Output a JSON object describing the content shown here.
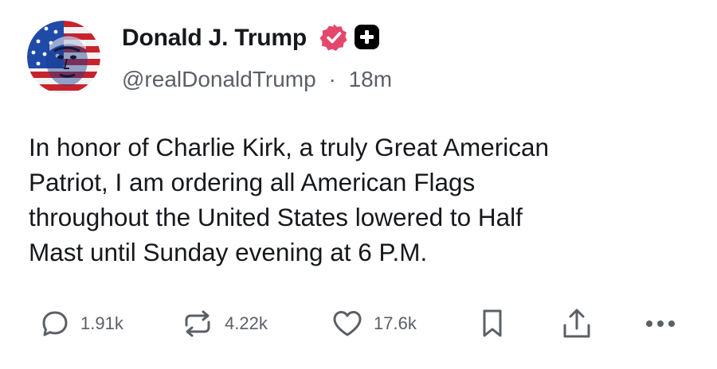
{
  "author": {
    "display_name": "Donald J. Trump",
    "handle": "@realDonaldTrump",
    "separator": "·",
    "timestamp": "18m",
    "avatar_icon": "flag-portrait-avatar",
    "verified_icon": "verified-badge-icon",
    "verified_color": "#e4476a",
    "plus_icon": "plus-badge-icon"
  },
  "post": {
    "text": "In honor of Charlie Kirk, a truly Great American\nPatriot, I am ordering all American Flags\nthroughout the United States lowered to Half\nMast until Sunday evening at 6 P.M."
  },
  "actions": {
    "reply": {
      "icon": "reply-bubble-icon",
      "count": "1.91k"
    },
    "repost": {
      "icon": "repost-arrows-icon",
      "count": "4.22k"
    },
    "like": {
      "icon": "heart-icon",
      "count": "17.6k"
    },
    "bookmark": {
      "icon": "bookmark-icon"
    },
    "share": {
      "icon": "share-upload-icon"
    },
    "more": {
      "icon": "more-dots-icon"
    }
  },
  "colors": {
    "text": "#16181c",
    "muted": "#5b5f66",
    "icon": "#5b5f66"
  }
}
